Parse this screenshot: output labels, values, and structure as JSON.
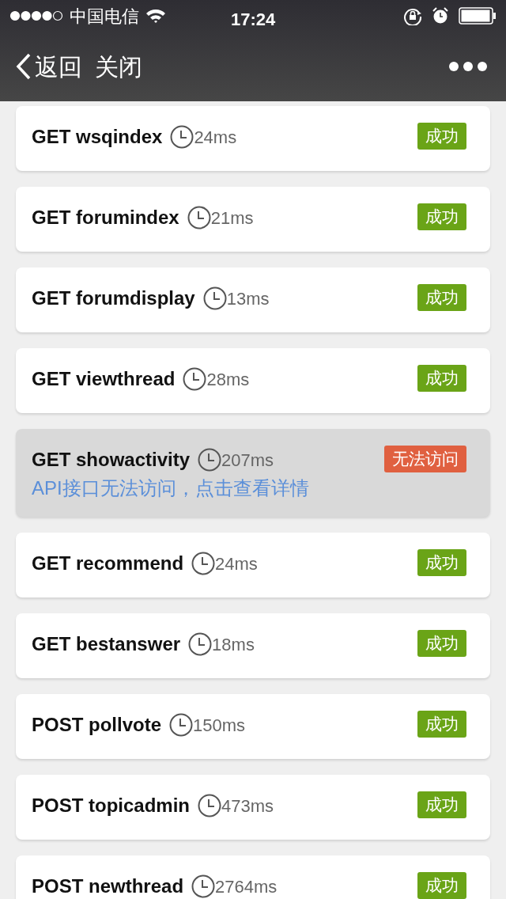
{
  "status_bar": {
    "carrier": "中国电信",
    "time": "17:24"
  },
  "nav": {
    "back": "返回",
    "close": "关闭"
  },
  "requests": [
    {
      "method": "GET",
      "name": "wsqindex",
      "duration": "24ms",
      "kind": "success",
      "badge": "成功"
    },
    {
      "method": "GET",
      "name": "forumindex",
      "duration": "21ms",
      "kind": "success",
      "badge": "成功"
    },
    {
      "method": "GET",
      "name": "forumdisplay",
      "duration": "13ms",
      "kind": "success",
      "badge": "成功"
    },
    {
      "method": "GET",
      "name": "viewthread",
      "duration": "28ms",
      "kind": "success",
      "badge": "成功"
    },
    {
      "method": "GET",
      "name": "showactivity",
      "duration": "207ms",
      "kind": "error",
      "badge": "无法访问",
      "message": "API接口无法访问，点击查看详情"
    },
    {
      "method": "GET",
      "name": "recommend",
      "duration": "24ms",
      "kind": "success",
      "badge": "成功"
    },
    {
      "method": "GET",
      "name": "bestanswer",
      "duration": "18ms",
      "kind": "success",
      "badge": "成功"
    },
    {
      "method": "POST",
      "name": "pollvote",
      "duration": "150ms",
      "kind": "success",
      "badge": "成功"
    },
    {
      "method": "POST",
      "name": "topicadmin",
      "duration": "473ms",
      "kind": "success",
      "badge": "成功"
    },
    {
      "method": "POST",
      "name": "newthread",
      "duration": "2764ms",
      "kind": "success",
      "badge": "成功"
    }
  ]
}
